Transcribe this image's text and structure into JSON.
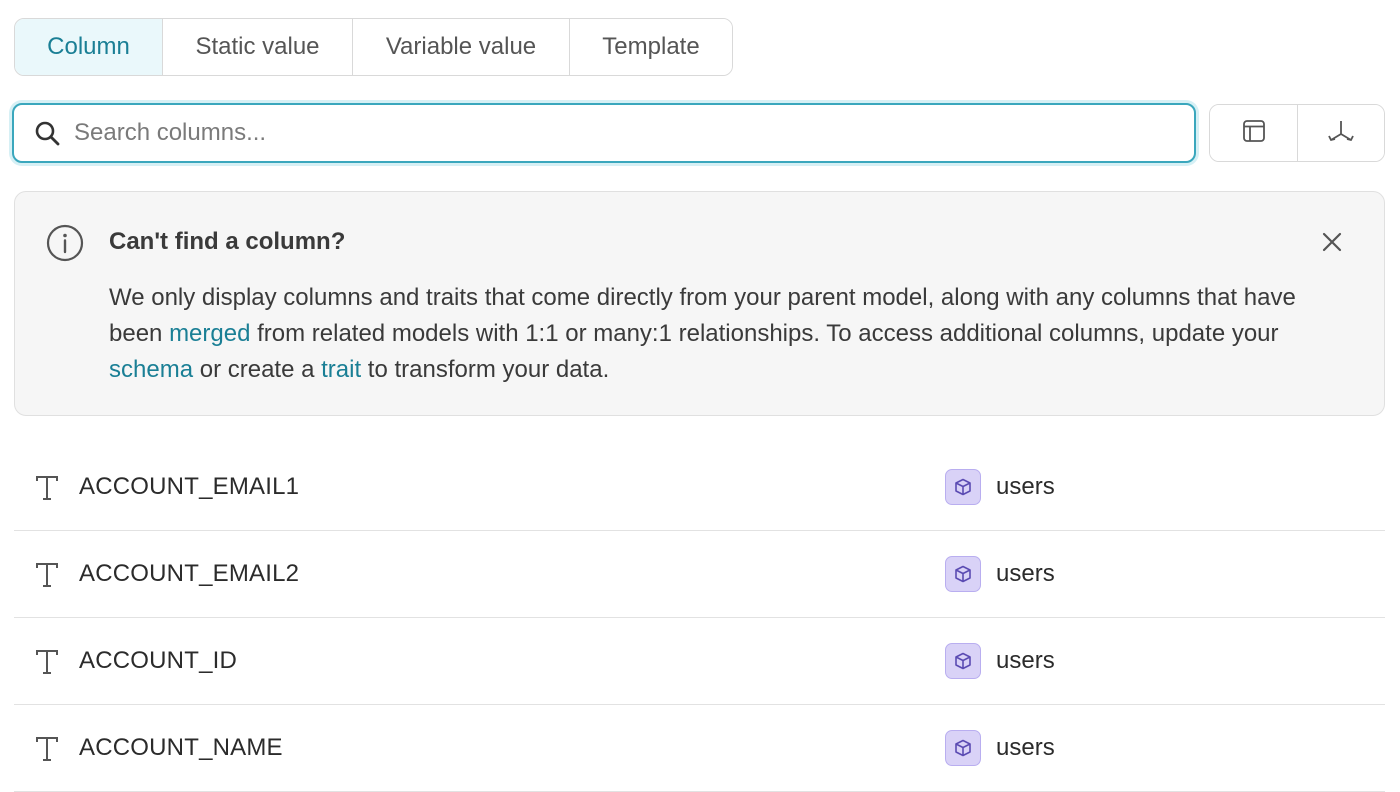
{
  "tabs": [
    {
      "label": "Column",
      "active": true
    },
    {
      "label": "Static value",
      "active": false
    },
    {
      "label": "Variable value",
      "active": false
    },
    {
      "label": "Template",
      "active": false
    }
  ],
  "search": {
    "placeholder": "Search columns...",
    "value": ""
  },
  "toolbar_icons": [
    "table-view-icon",
    "merge-relationships-icon"
  ],
  "banner": {
    "title": "Can't find a column?",
    "body_parts": [
      {
        "text": "We only display columns and traits that come directly from your parent model, along with any columns that have been ",
        "link": false
      },
      {
        "text": "merged",
        "link": true
      },
      {
        "text": " from related models with 1:1 or many:1 relationships. To access additional columns, update your ",
        "link": false
      },
      {
        "text": "schema",
        "link": true
      },
      {
        "text": " or create a ",
        "link": false
      },
      {
        "text": "trait",
        "link": true
      },
      {
        "text": " to transform your data.",
        "link": false
      }
    ]
  },
  "columns": [
    {
      "name": "ACCOUNT_EMAIL1",
      "type_icon": "text-type-icon",
      "model": "users"
    },
    {
      "name": "ACCOUNT_EMAIL2",
      "type_icon": "text-type-icon",
      "model": "users"
    },
    {
      "name": "ACCOUNT_ID",
      "type_icon": "text-type-icon",
      "model": "users"
    },
    {
      "name": "ACCOUNT_NAME",
      "type_icon": "text-type-icon",
      "model": "users"
    }
  ],
  "colors": {
    "accent": "#1a7f95",
    "active_tab_bg": "#eaf8fb",
    "model_badge_bg": "#d9d2f7",
    "model_badge_icon": "#5b4bb3"
  }
}
